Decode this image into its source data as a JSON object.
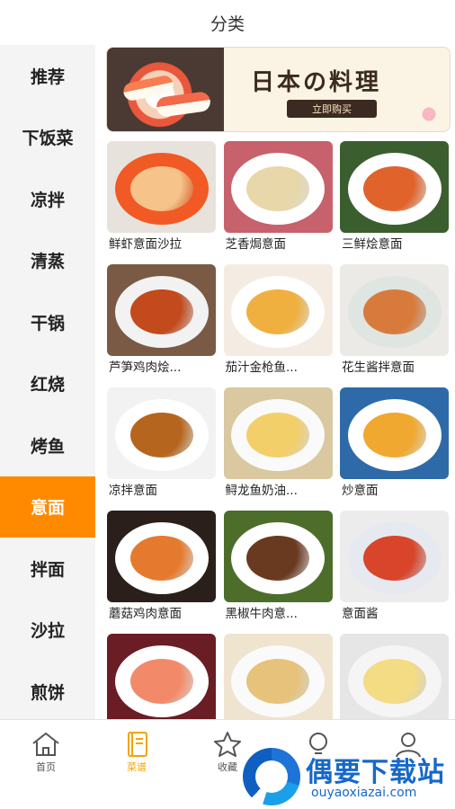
{
  "header": {
    "title": "分类"
  },
  "sidebar": {
    "items": [
      {
        "label": "推荐",
        "active": false
      },
      {
        "label": "下饭菜",
        "active": false
      },
      {
        "label": "凉拌",
        "active": false
      },
      {
        "label": "清蒸",
        "active": false
      },
      {
        "label": "干锅",
        "active": false
      },
      {
        "label": "红烧",
        "active": false
      },
      {
        "label": "烤鱼",
        "active": false
      },
      {
        "label": "意面",
        "active": true
      },
      {
        "label": "拌面",
        "active": false
      },
      {
        "label": "沙拉",
        "active": false
      },
      {
        "label": "煎饼",
        "active": false
      }
    ]
  },
  "banner": {
    "title": "日本の料理",
    "button": "立即购买"
  },
  "recipes": [
    {
      "name": "鲜虾意面沙拉",
      "bg": "#e8e2dc",
      "plate": "#f15a24",
      "food": "#f6c38a"
    },
    {
      "name": "芝香焗意面",
      "bg": "#c7616c",
      "plate": "#ffffff",
      "food": "#e8d7a8"
    },
    {
      "name": "三鲜烩意面",
      "bg": "#3b5e2f",
      "plate": "#ffffff",
      "food": "#e0632c"
    },
    {
      "name": "芦笋鸡肉烩...",
      "bg": "#7a5a44",
      "plate": "#f2f2f2",
      "food": "#c24a1c"
    },
    {
      "name": "茄汁金枪鱼...",
      "bg": "#f4ece2",
      "plate": "#ffffff",
      "food": "#f0b040"
    },
    {
      "name": "花生酱拌意面",
      "bg": "#eceae6",
      "plate": "#dfe5e0",
      "food": "#d87a3c"
    },
    {
      "name": "凉拌意面",
      "bg": "#f2f2f2",
      "plate": "#ffffff",
      "food": "#b5651d"
    },
    {
      "name": "鲟龙鱼奶油...",
      "bg": "#d9c8a0",
      "plate": "#fafafa",
      "food": "#f3cf6a"
    },
    {
      "name": "炒意面",
      "bg": "#2e6aa8",
      "plate": "#ffffff",
      "food": "#f0a830"
    },
    {
      "name": "蘑菇鸡肉意面",
      "bg": "#2b1f1b",
      "plate": "#ffffff",
      "food": "#e57a2e"
    },
    {
      "name": "黑椒牛肉意...",
      "bg": "#4d6e2a",
      "plate": "#ffffff",
      "food": "#6a3a20"
    },
    {
      "name": "意面酱",
      "bg": "#ececec",
      "plate": "#e6e9f0",
      "food": "#d8452a"
    },
    {
      "name": "",
      "bg": "#6a1d24",
      "plate": "#ffffff",
      "food": "#f28a6a"
    },
    {
      "name": "",
      "bg": "#efe4d0",
      "plate": "#fafafa",
      "food": "#e6c27a"
    },
    {
      "name": "",
      "bg": "#e6e6e6",
      "plate": "#f5f5f5",
      "food": "#f3dc84"
    }
  ],
  "tabs": [
    {
      "label": "首页",
      "icon": "home-icon",
      "active": false
    },
    {
      "label": "菜谱",
      "icon": "recipe-book-icon",
      "active": true
    },
    {
      "label": "收藏",
      "icon": "star-icon",
      "active": false
    },
    {
      "label": "",
      "icon": "bulb-icon",
      "active": false
    },
    {
      "label": "",
      "icon": "user-icon",
      "active": false
    }
  ],
  "watermark": {
    "text": "偶要下载站",
    "url": "ouyaoxiazai.com"
  },
  "colors": {
    "accent": "#ff8a00",
    "tab_active": "#f0a500",
    "sidebar_bg": "#f4f4f4"
  }
}
